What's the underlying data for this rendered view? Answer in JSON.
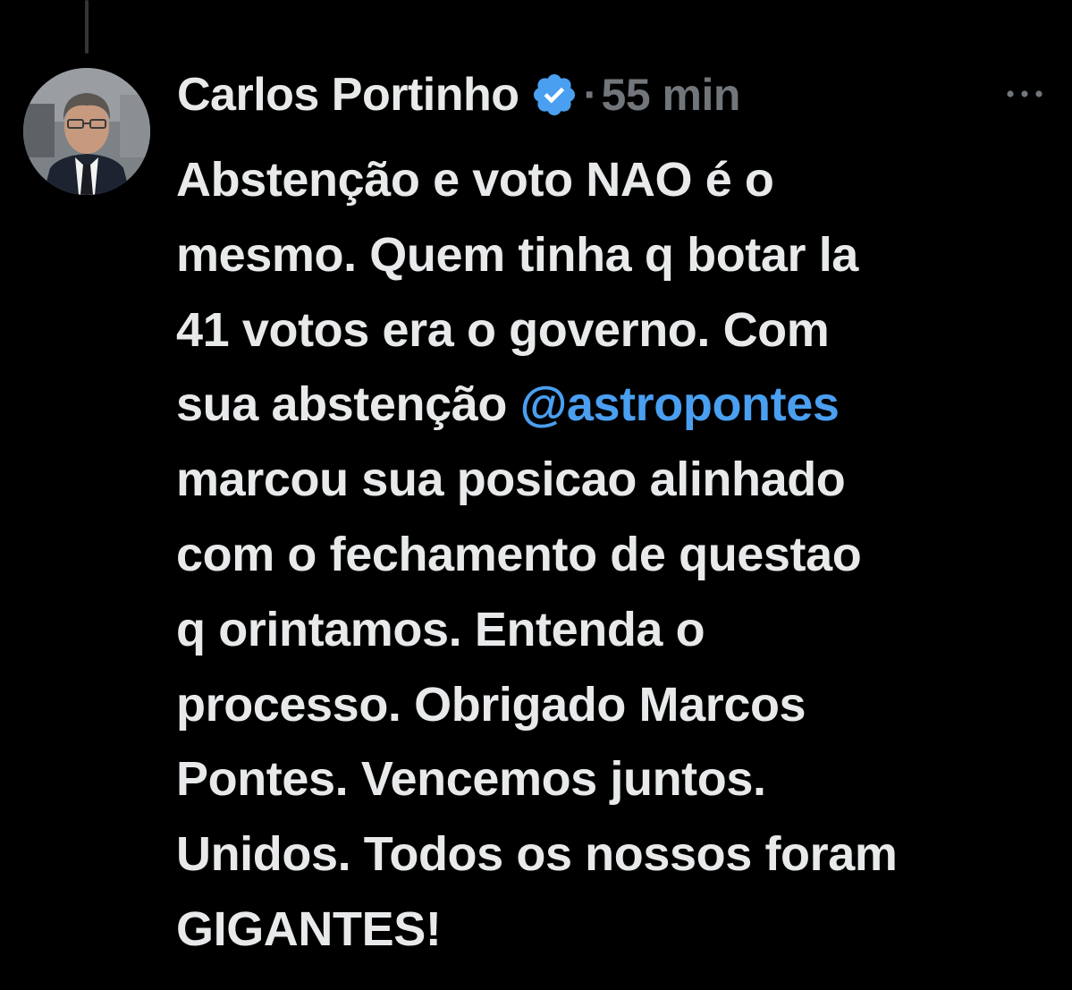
{
  "tweet": {
    "author_name": "Carlos Portinho",
    "separator": "·",
    "timestamp": "55 min",
    "verified_color": "#4a9ff0",
    "avatar_icon": "profile-photo",
    "more_icon": "more-horizontal-icon",
    "text_lines": [
      {
        "before": "Abstenção e voto NAO é o"
      },
      {
        "before": "mesmo. Quem tinha q botar la"
      },
      {
        "before": "41 votos era o governo. Com"
      },
      {
        "before": "sua abstenção ",
        "mention": "@astropontes"
      },
      {
        "before": "marcou sua posicao alinhado"
      },
      {
        "before": "com o fechamento de questao"
      },
      {
        "before": "q orintamos. Entenda o"
      },
      {
        "before": "processo. Obrigado Marcos"
      },
      {
        "before": "Pontes. Vencemos juntos."
      },
      {
        "before": "Unidos. Todos os nossos foram"
      },
      {
        "before": "GIGANTES!"
      }
    ]
  }
}
